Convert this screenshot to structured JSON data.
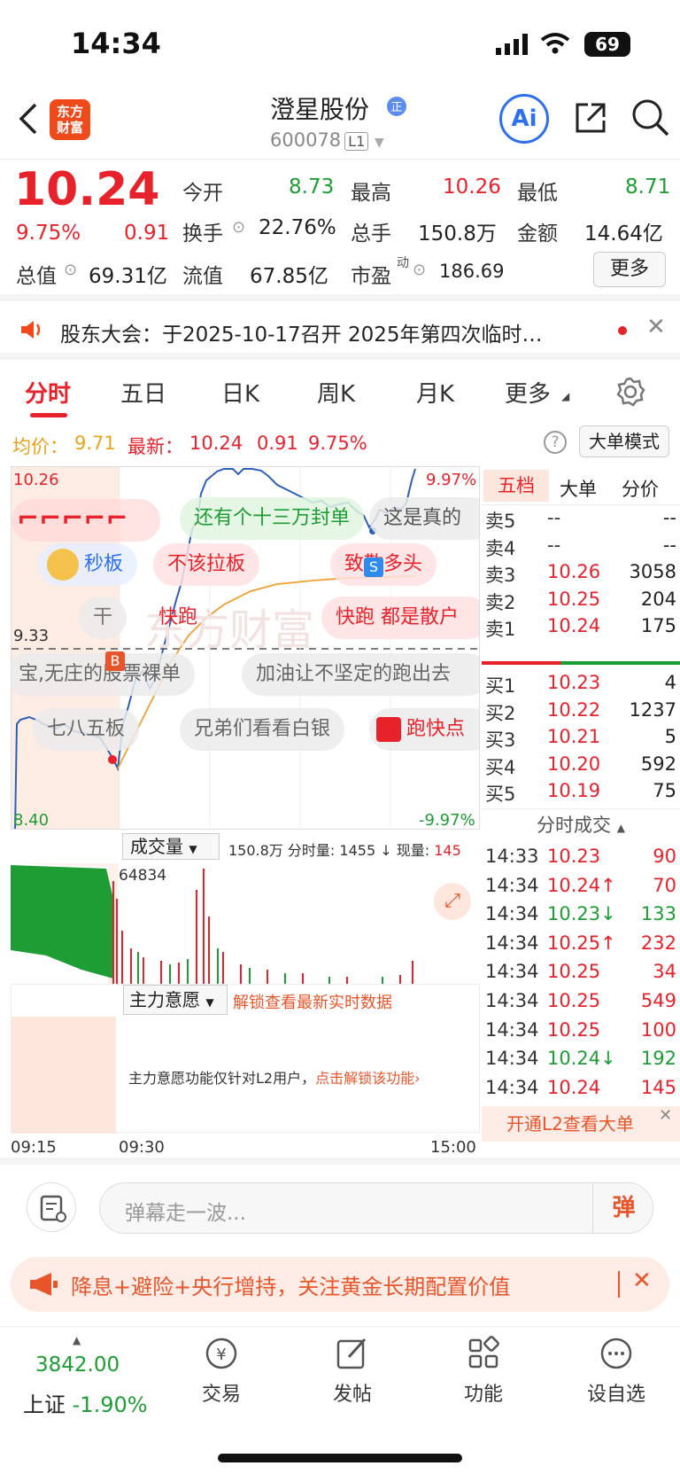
{
  "status": {
    "time": "14:34",
    "battery": "69"
  },
  "header": {
    "name": "澄星股份",
    "code": "600078",
    "level": "L1",
    "logo": "东方\n财富",
    "ai": "Ai"
  },
  "quote": {
    "price": "10.24",
    "pct": "9.75%",
    "chg": "0.91",
    "open_l": "今开",
    "open": "8.73",
    "high_l": "最高",
    "high": "10.26",
    "low_l": "最低",
    "low": "8.71",
    "turn_l": "换手",
    "turn": "22.76%",
    "vol_l": "总手",
    "vol": "150.8万",
    "amt_l": "金额",
    "amt": "14.64亿",
    "mcap_l": "总值",
    "mcap": "69.31亿",
    "fcap_l": "流值",
    "fcap": "67.85亿",
    "pe_l": "市盈",
    "pe_sup": "动",
    "pe": "186.69",
    "more": "更多"
  },
  "notice": {
    "text": "股东大会：于2025-10-17召开 2025年第四次临时…"
  },
  "tabs": [
    "分时",
    "五日",
    "日K",
    "周K",
    "月K",
    "更多"
  ],
  "info": {
    "avg_l": "均价：",
    "avg": "9.71",
    "last_l": "最新：",
    "last": "10.24",
    "chg": "0.91",
    "pct": "9.75%",
    "mode": "大单模式"
  },
  "chart": {
    "top": "10.26",
    "mid": "9.33",
    "bottom": "8.40",
    "pct_top": "9.97%",
    "pct_bottom": "-9.97%",
    "watermark": "东方财富"
  },
  "bubbles": [
    "还有个十三万封单",
    "这是真的",
    "秒板",
    "不该拉板",
    "致敬多头",
    "干",
    "快跑",
    "快跑 都是散户",
    "宝,无庄的股票裸单",
    "加油让不坚定的跑出去",
    "七八五板",
    "兄弟们看看白银",
    "跑快点"
  ],
  "vol": {
    "dropdown": "成交量",
    "total": "150.8万",
    "min_vol_l": "分时量:",
    "min_vol": "1455",
    "cur_l": "现量:",
    "cur": "145",
    "peak": "64834"
  },
  "main": {
    "dropdown": "主力意愿",
    "unlock": "解锁查看最新实时数据",
    "msg": "主力意愿功能仅针对L2用户，",
    "link": "点击解锁该功能"
  },
  "xaxis": [
    "09:15",
    "09:30",
    "15:00"
  ],
  "panel": {
    "tabs": [
      "五档",
      "大单",
      "分价"
    ],
    "asks": [
      {
        "l": "卖5",
        "p": "--",
        "v": "--"
      },
      {
        "l": "卖4",
        "p": "--",
        "v": "--"
      },
      {
        "l": "卖3",
        "p": "10.26",
        "v": "3058"
      },
      {
        "l": "卖2",
        "p": "10.25",
        "v": "204"
      },
      {
        "l": "卖1",
        "p": "10.24",
        "v": "175"
      }
    ],
    "bids": [
      {
        "l": "买1",
        "p": "10.23",
        "v": "4"
      },
      {
        "l": "买2",
        "p": "10.22",
        "v": "1237"
      },
      {
        "l": "买3",
        "p": "10.21",
        "v": "5"
      },
      {
        "l": "买4",
        "p": "10.20",
        "v": "592"
      },
      {
        "l": "买5",
        "p": "10.19",
        "v": "75"
      }
    ],
    "ticks_title": "分时成交",
    "ticks": [
      {
        "t": "14:33",
        "p": "10.23",
        "v": "90",
        "c": "red"
      },
      {
        "t": "14:34",
        "p": "10.24↑",
        "v": "70",
        "c": "red"
      },
      {
        "t": "14:34",
        "p": "10.23↓",
        "v": "133",
        "c": "green"
      },
      {
        "t": "14:34",
        "p": "10.25↑",
        "v": "232",
        "c": "red"
      },
      {
        "t": "14:34",
        "p": "10.25",
        "v": "34",
        "c": "red"
      },
      {
        "t": "14:34",
        "p": "10.25",
        "v": "549",
        "c": "red"
      },
      {
        "t": "14:34",
        "p": "10.25",
        "v": "100",
        "c": "red"
      },
      {
        "t": "14:34",
        "p": "10.24↓",
        "v": "192",
        "c": "green"
      },
      {
        "t": "14:34",
        "p": "10.24",
        "v": "145",
        "c": "red"
      }
    ],
    "l2": "开通L2查看大单"
  },
  "danmu": {
    "placeholder": "弹幕走一波...",
    "btn": "弹"
  },
  "ad": {
    "text": "降息+避险+央行增持，关注黄金长期配置价值"
  },
  "bottom": {
    "index": "3842.00",
    "index_name": "上证",
    "index_pct": "-1.90%",
    "nav": [
      "交易",
      "发帖",
      "功能",
      "设自选"
    ]
  }
}
